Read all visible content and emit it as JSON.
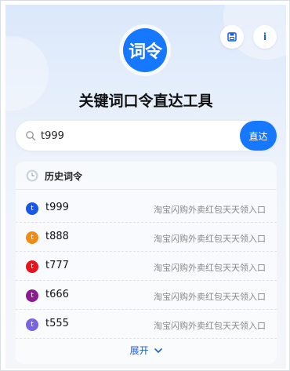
{
  "logo": {
    "text": "词令"
  },
  "header": {
    "title": "关键词口令直达工具"
  },
  "top_buttons": {
    "save_icon": "floppy-disk-icon",
    "info_label": "i"
  },
  "search": {
    "value": "t999",
    "button_label": "直达",
    "icon": "search-icon"
  },
  "history": {
    "title": "历史词令",
    "items": [
      {
        "code": "t999",
        "badge": "t",
        "color": "#1a56e8",
        "desc": "淘宝闪购外卖红包天天领入口"
      },
      {
        "code": "t888",
        "badge": "t",
        "color": "#f08c12",
        "desc": "淘宝闪购外卖红包天天领入口"
      },
      {
        "code": "t777",
        "badge": "t",
        "color": "#e8141c",
        "desc": "淘宝闪购外卖红包天天领入口"
      },
      {
        "code": "t666",
        "badge": "t",
        "color": "#8d1a8f",
        "desc": "淘宝闪购外卖红包天天领入口"
      },
      {
        "code": "t555",
        "badge": "t",
        "color": "#7a63e0",
        "desc": "淘宝闪购外卖红包天天领入口"
      }
    ],
    "expand_label": "展开"
  }
}
